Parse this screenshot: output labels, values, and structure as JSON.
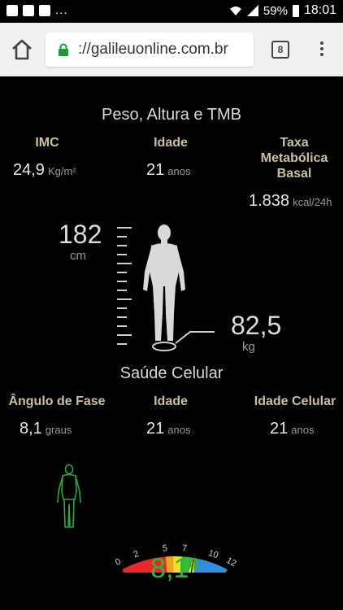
{
  "status_bar": {
    "notif_more": "...",
    "battery": "59%",
    "time": "18:01"
  },
  "browser": {
    "url": "://galileuonline.com.br",
    "tab_count": "8"
  },
  "peso_section": {
    "title": "Peso, Altura e TMB",
    "imc": {
      "label": "IMC",
      "value": "24,9",
      "unit": "Kg/m²"
    },
    "idade": {
      "label": "Idade",
      "value": "21",
      "unit": "anos"
    },
    "tmb": {
      "label_line1": "Taxa",
      "label_line2": "Metabólica",
      "label_line3": "Basal",
      "value": "1.838",
      "unit": "kcal/24h"
    },
    "altura": {
      "value": "182",
      "unit": "cm"
    },
    "peso": {
      "value": "82,5",
      "unit": "kg"
    }
  },
  "saude_section": {
    "title": "Saúde Celular",
    "angulo": {
      "label": "Ângulo de Fase",
      "value": "8,1",
      "unit": "graus"
    },
    "idade": {
      "label": "Idade",
      "value": "21",
      "unit": "anos"
    },
    "idade_celular": {
      "label": "Idade Celular",
      "value": "21",
      "unit": "anos"
    }
  },
  "gauge": {
    "value": 8.1,
    "value_label": "8,1º",
    "min": 0,
    "max": 12,
    "tick_labels": [
      "0",
      "2",
      "5",
      "7",
      "10",
      "12"
    ],
    "colors": {
      "red": "#f0252a",
      "orange": "#f5a31a",
      "yellow": "#e6e12b",
      "green": "#38b83c",
      "blue": "#2f8fe0",
      "pointer": "#f5ef1e",
      "value_text": "#33b533"
    }
  }
}
